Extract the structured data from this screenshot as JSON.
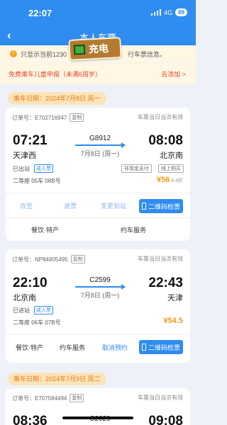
{
  "status": {
    "time": "22:07",
    "network": "4G",
    "battery": "89"
  },
  "nav": {
    "title": "本人车票"
  },
  "stamp_text": "充电",
  "notice": {
    "left": "只显示当前1230",
    "right": "行车票信息。"
  },
  "child": {
    "label": "免费乘车儿童申报（未满6周岁）",
    "action": "去添加 >"
  },
  "date1": "乘车日期：2024年7月8日 周一",
  "date2": "乘车日期：2024年7月9日 周二",
  "tickets": [
    {
      "order": "订单号：E702716947",
      "copy": "复制",
      "valid": "车票当日当次有效",
      "dep_time": "07:21",
      "dep_station": "天津西",
      "train": "G8912",
      "date": "7月8日 (周一)",
      "arr_time": "08:08",
      "arr_station": "北京南",
      "status": "已出站",
      "type_tag": "成人票",
      "tag_a": "非现金支付",
      "tag_b": "线上购买",
      "seat": "二等座 05车 08B号",
      "price": "¥56",
      "discount": "8.4折",
      "actions": [
        "改签",
        "退票",
        "变更到站"
      ],
      "qr": "二维码检票",
      "food": "餐饮·特产",
      "service": "约车服务"
    },
    {
      "order": "订单号：NP84805495",
      "copy": "复制",
      "valid": "车票当日当次有效",
      "dep_time": "22:10",
      "dep_station": "北京南",
      "train": "C2599",
      "date": "7月8日 (周一)",
      "arr_time": "22:43",
      "arr_station": "天津",
      "status": "已进站",
      "type_tag": "成人票",
      "seat": "二等座 06车 07B号",
      "price": "¥54.5",
      "food": "餐饮·特产",
      "service": "约车服务",
      "cancel": "取消预约",
      "qr": "二维码检票"
    },
    {
      "order": "订单号：E707584494",
      "copy": "复制",
      "valid": "车票当日当次有效",
      "dep_time": "08:36",
      "train": "C2629",
      "arr_time": "09:08"
    }
  ],
  "colors": {
    "primary": "#2f8cf0",
    "orange": "#f39a17",
    "red": "#e4492c"
  }
}
